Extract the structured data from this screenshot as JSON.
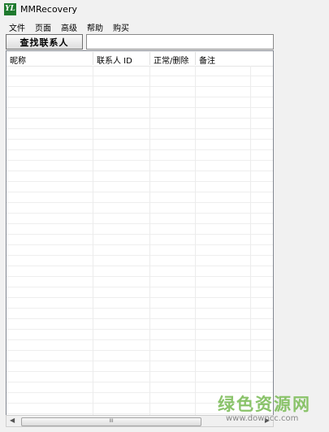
{
  "window": {
    "title": "MMRecovery",
    "icon_text": "YL"
  },
  "menu": [
    "文件",
    "页面",
    "高级",
    "帮助",
    "购买"
  ],
  "toolbar": {
    "find_contacts_label": "查找联系人",
    "search_value": ""
  },
  "list": {
    "columns": [
      "昵称",
      "联系人 ID",
      "正常/删除",
      "备注"
    ],
    "rows": []
  },
  "scrollbar": {
    "left_arrow": "◀",
    "right_arrow": "▶",
    "grip": "III"
  },
  "watermark": {
    "text": "绿色资源网",
    "url": "www.downcc.com"
  },
  "colors": {
    "watermark": "#8ac36a",
    "icon_bg": "#1f7a2e"
  }
}
